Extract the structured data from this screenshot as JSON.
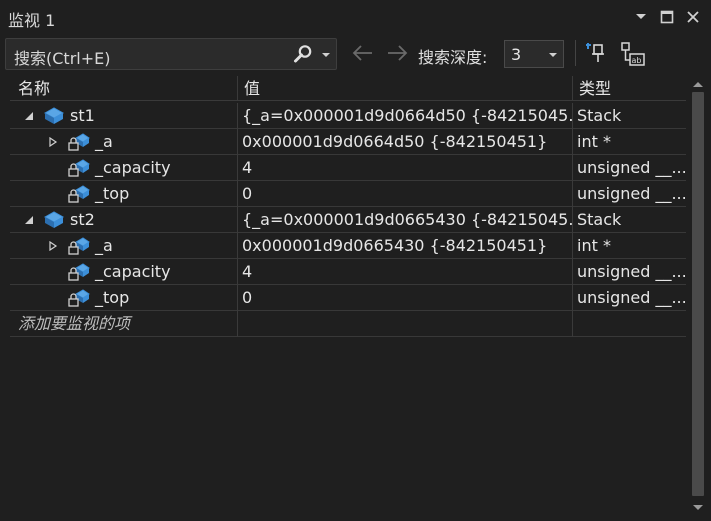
{
  "window": {
    "title": "监视 1"
  },
  "toolbar": {
    "search_placeholder": "搜索(Ctrl+E)",
    "depth_label": "搜索深度:",
    "depth_value": "3"
  },
  "columns": {
    "name": "名称",
    "value": "值",
    "type": "类型"
  },
  "rows": [
    {
      "name": "st1",
      "value": "{_a=0x000001d9d0664d50 {-84215045...",
      "type": "Stack"
    },
    {
      "name": "_a",
      "value": "0x000001d9d0664d50 {-842150451}",
      "type": "int *"
    },
    {
      "name": "_capacity",
      "value": "4",
      "type": "unsigned __..."
    },
    {
      "name": "_top",
      "value": "0",
      "type": "unsigned __..."
    },
    {
      "name": "st2",
      "value": "{_a=0x000001d9d0665430 {-84215045...",
      "type": "Stack"
    },
    {
      "name": "_a",
      "value": "0x000001d9d0665430 {-842150451}",
      "type": "int *"
    },
    {
      "name": "_capacity",
      "value": "4",
      "type": "unsigned __..."
    },
    {
      "name": "_top",
      "value": "0",
      "type": "unsigned __..."
    }
  ],
  "add_item_text": "添加要监视的项",
  "icons": {
    "menu": "chevron-down-icon",
    "maximize": "maximize-icon",
    "close": "close-icon",
    "search": "search-icon",
    "back": "arrow-left-icon",
    "forward": "arrow-right-icon",
    "pin": "pin-icon",
    "hex": "hex-display-icon",
    "object": "object-icon",
    "lock": "private-member-icon"
  },
  "colors": {
    "background": "#1f1f1f",
    "object_icon": "#3c8fd9",
    "lock_icon": "#d0d0d0"
  }
}
